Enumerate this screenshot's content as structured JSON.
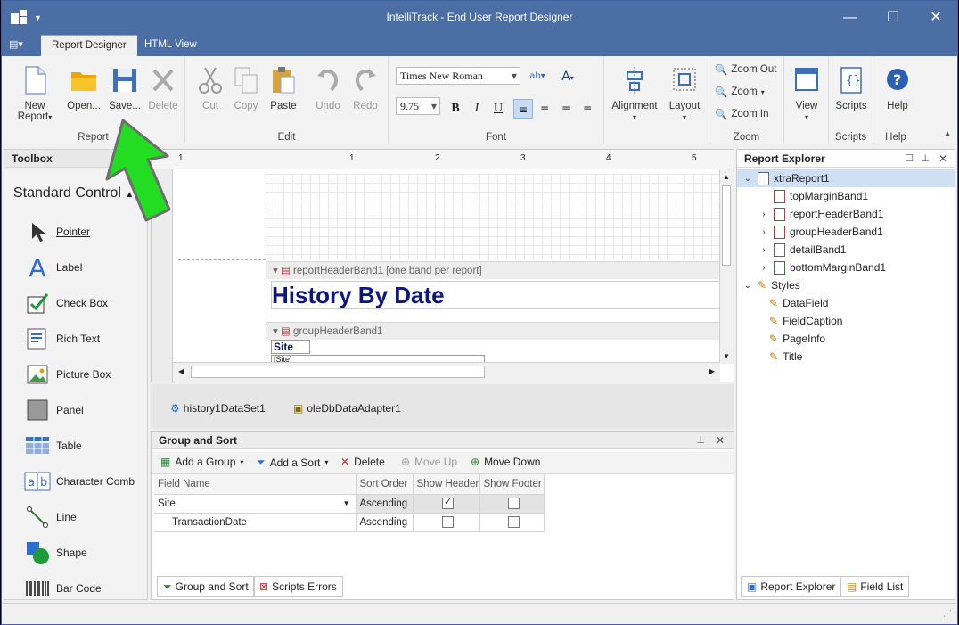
{
  "window": {
    "title": "IntelliTrack - End User Report Designer"
  },
  "tabs": [
    "Report Designer",
    "HTML View"
  ],
  "ribbon": {
    "report": {
      "label": "Report",
      "new": "New Report",
      "open": "Open...",
      "save": "Save...",
      "delete": "Delete"
    },
    "edit": {
      "label": "Edit",
      "cut": "Cut",
      "copy": "Copy",
      "paste": "Paste",
      "undo": "Undo",
      "redo": "Redo"
    },
    "font": {
      "label": "Font",
      "family": "Times New Roman",
      "size": "9.75"
    },
    "alignment": "Alignment",
    "layout": "Layout",
    "zoom": {
      "label": "Zoom",
      "out": "Zoom Out",
      "zoom": "Zoom",
      "in": "Zoom In"
    },
    "view": "View",
    "scripts": {
      "label": "Scripts",
      "btn": "Scripts"
    },
    "help": {
      "label": "Help",
      "btn": "Help"
    }
  },
  "toolbox": {
    "title": "Toolbox",
    "category": "Standard Control",
    "items": [
      "Pointer",
      "Label",
      "Check Box",
      "Rich Text",
      "Picture Box",
      "Panel",
      "Table",
      "Character Comb",
      "Line",
      "Shape",
      "Bar Code"
    ]
  },
  "designer": {
    "ruler": [
      "1",
      "1",
      "2",
      "3",
      "4",
      "5"
    ],
    "band_report_header": "reportHeaderBand1 [one band per report]",
    "report_title": "History By Date",
    "band_group_header": "groupHeaderBand1",
    "site_label": "Site",
    "site_field": "[Site]"
  },
  "tray": [
    "history1DataSet1",
    "oleDbDataAdapter1"
  ],
  "group_sort": {
    "title": "Group and Sort",
    "toolbar": {
      "add_group": "Add a Group",
      "add_sort": "Add a Sort",
      "delete": "Delete",
      "move_up": "Move Up",
      "move_down": "Move Down"
    },
    "columns": [
      "Field Name",
      "Sort Order",
      "Show Header",
      "Show Footer"
    ],
    "rows": [
      {
        "field": "Site",
        "order": "Ascending",
        "header": true,
        "footer": false
      },
      {
        "field": "TransactionDate",
        "order": "Ascending",
        "header": false,
        "footer": false
      }
    ],
    "tabs": [
      "Group and Sort",
      "Scripts Errors"
    ]
  },
  "report_explorer": {
    "title": "Report Explorer",
    "root": "xtraReport1",
    "bands": [
      "topMarginBand1",
      "reportHeaderBand1",
      "groupHeaderBand1",
      "detailBand1",
      "bottomMarginBand1"
    ],
    "styles_label": "Styles",
    "styles": [
      "DataField",
      "FieldCaption",
      "PageInfo",
      "Title"
    ],
    "tabs": [
      "Report Explorer",
      "Field List"
    ]
  },
  "colors": {
    "titlebar": "#4b6ea4",
    "accent_green": "#22dd22",
    "title_text": "#0c1680"
  }
}
